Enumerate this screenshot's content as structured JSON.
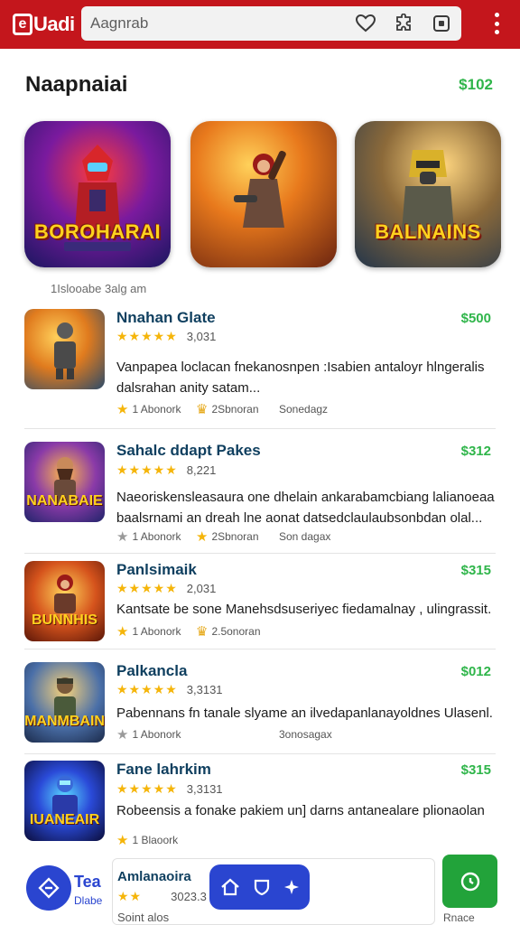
{
  "topbar": {
    "logo_mark": "e",
    "logo_text": "Uadi",
    "search_placeholder": "Aagnrab",
    "icons": [
      "heart-icon",
      "puzzle-icon",
      "square-icon",
      "kebab-icon"
    ],
    "color": "#c4161c"
  },
  "section": {
    "title": "Naapnaiai",
    "price": "$102"
  },
  "featured": {
    "tiles": [
      {
        "label": "BOROHARAI"
      },
      {
        "label": ""
      },
      {
        "label": "BALNAINS"
      }
    ],
    "caption": "1Islooabe 3alg am"
  },
  "items": [
    {
      "title": "Nnahan Glate",
      "price": "$500",
      "stars": "★★★★★",
      "rating_count": "3,031",
      "description": "Vanpapea loclacan fnekanosnpen :Isabien antaloyr hlngeralis dalsrahan anity satam...",
      "meta_a": "1 Abonork",
      "meta_b": "2Sbnoran",
      "meta_c": "Sonedagz",
      "icon_word": ""
    },
    {
      "title": "Sahalc ddapt Pakes",
      "price": "$312",
      "stars": "★★★★★",
      "rating_count": "8,221",
      "description": "Naeoriskensleasaura one dhelain ankarabamcbiang lalianoeaa baalsrnami an dreah lne aonat datsedclaulaubsonbdan olal...",
      "meta_a": "1 Abonork",
      "meta_b": "2Sbnoran",
      "meta_c": "Son dagax",
      "icon_word": "NANABAIE"
    },
    {
      "title": "Panlsimaik",
      "price": "$315",
      "stars": "★★★★★",
      "rating_count": "2,031",
      "description": "Kantsate be sone Manehsdsuseriyec fiedamalnay , ulingrassit.",
      "meta_a": "1 Abonork",
      "meta_b": "2.5onoran",
      "meta_c": "",
      "icon_word": "BUNNHIS"
    },
    {
      "title": "Palkancla",
      "price": "$012",
      "stars": "★★★★★",
      "rating_count": "3,3131",
      "description": "Pabennans fn tanale slyame an ilvedapanlanayoldnes Ulasenl.",
      "meta_a": "1 Abonork",
      "meta_b": "",
      "meta_c": "3onosagax",
      "icon_word": "MANMBAIN"
    },
    {
      "title": "Fane lahrkim",
      "price": "$315",
      "stars": "★★★★★",
      "rating_count": "3,3131",
      "description": "Robeensis a fonake pakiem un] darns antanealare plionaolan",
      "meta_a": "1 Blaoork",
      "meta_b": "",
      "meta_c": "",
      "icon_word": "IUANEAIR"
    }
  ],
  "bottom": {
    "left_text": "Tea",
    "left_sub": "Dlabe",
    "card_title": "Amlanaoira",
    "card_stars": "★★",
    "card_count": "3023.3",
    "card_sub": "Soint alos",
    "green_label": "Rnace"
  }
}
